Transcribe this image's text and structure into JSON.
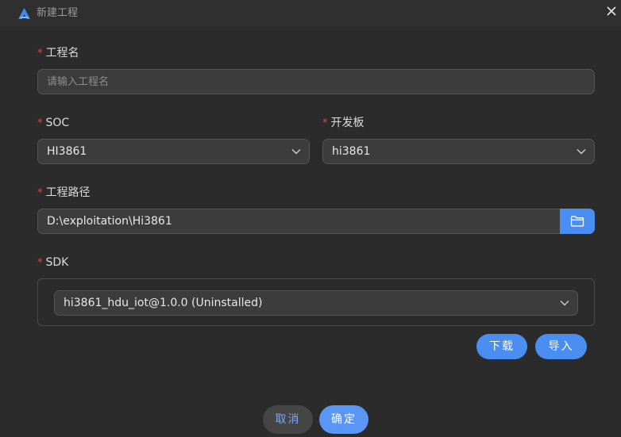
{
  "window": {
    "title": "新建工程",
    "close_icon": "close-icon",
    "app_icon": "app-logo-icon"
  },
  "form": {
    "project_name": {
      "label": "工程名",
      "required": "*",
      "placeholder": "请输入工程名",
      "value": ""
    },
    "soc": {
      "label": "SOC",
      "required": "*",
      "selected": "HI3861"
    },
    "board": {
      "label": "开发板",
      "required": "*",
      "selected": "hi3861"
    },
    "project_path": {
      "label": "工程路径",
      "required": "*",
      "value": "D:\\exploitation\\Hi3861",
      "browse_icon": "folder-icon"
    },
    "sdk": {
      "label": "SDK",
      "required": "*",
      "selected": "hi3861_hdu_iot@1.0.0 (Uninstalled)"
    }
  },
  "sdk_actions": {
    "download": "下载",
    "import": "导入"
  },
  "footer": {
    "cancel": "取消",
    "confirm": "确定"
  },
  "colors": {
    "accent": "#4b8ef2",
    "required": "#e0483f",
    "background": "#2b2b2b"
  }
}
